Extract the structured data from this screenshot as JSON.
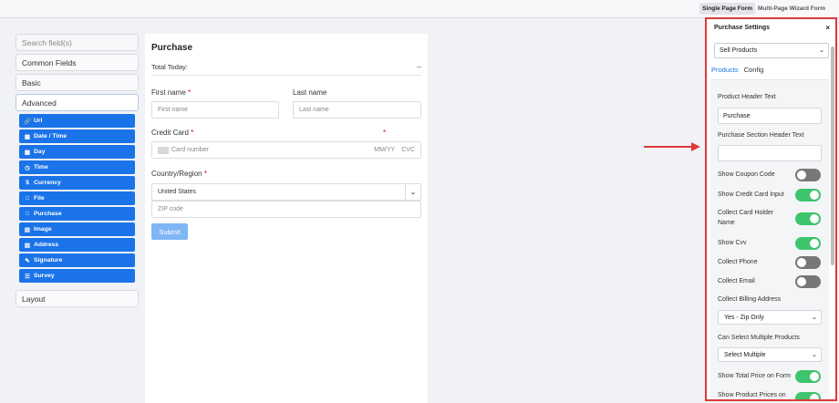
{
  "topbar": {
    "modes": [
      "Single Page Form",
      "Multi-Page Wizard Form"
    ],
    "active_mode": "Single Page Form"
  },
  "sidebar": {
    "search_placeholder": "Search field(s)",
    "sections": {
      "common": "Common Fields",
      "basic": "Basic",
      "advanced": "Advanced",
      "layout": "Layout"
    },
    "advanced_items": [
      {
        "label": "Url",
        "icon": "link-icon"
      },
      {
        "label": "Date / Time",
        "icon": "calendar-icon"
      },
      {
        "label": "Day",
        "icon": "calendar-icon"
      },
      {
        "label": "Time",
        "icon": "clock-icon"
      },
      {
        "label": "Currency",
        "icon": "dollar-icon"
      },
      {
        "label": "File",
        "icon": "file-icon"
      },
      {
        "label": "Purchase",
        "icon": "file-icon"
      },
      {
        "label": "Image",
        "icon": "image-icon"
      },
      {
        "label": "Address",
        "icon": "address-card-icon"
      },
      {
        "label": "Signature",
        "icon": "pen-icon"
      },
      {
        "label": "Survey",
        "icon": "list-icon"
      }
    ]
  },
  "form": {
    "title": "Purchase",
    "total_label": "Total Today:",
    "total_value": "--",
    "first_name_label": "First name",
    "first_name_placeholder": "First name",
    "last_name_label": "Last name",
    "last_name_placeholder": "Last name",
    "credit_card_label": "Credit Card",
    "required_mark": "*",
    "card_number_placeholder": "Card number",
    "card_expiry_placeholder": "MM/YY",
    "card_cvc_placeholder": "CVC",
    "country_label": "Country/Region",
    "country_value": "United States",
    "zip_placeholder": "ZIP code",
    "submit_label": "Submit"
  },
  "panel": {
    "title": "Purchase Settings",
    "close": "×",
    "type_select": "Sell Products",
    "tabs": [
      "Products",
      "Config"
    ],
    "product_header_label": "Product Header Text",
    "product_header_value": "Purchase",
    "section_header_label": "Purchase Section Header Text",
    "section_header_value": "",
    "toggles": {
      "coupon": {
        "label": "Show Coupon Code",
        "on": false
      },
      "credit_card": {
        "label": "Show Credit Card Input",
        "on": true
      },
      "holder": {
        "label": "Collect Card Holder Name",
        "on": true
      },
      "cvv": {
        "label": "Show Cvv",
        "on": true
      },
      "phone": {
        "label": "Collect Phone",
        "on": false
      },
      "email": {
        "label": "Collect Email",
        "on": false
      },
      "total_price": {
        "label": "Show Total Price on Form",
        "on": true
      },
      "product_prices": {
        "label": "Show Product Prices on",
        "on": true
      }
    },
    "billing_label": "Collect Billing Address",
    "billing_value": "Yes - Zip Only",
    "multi_label": "Can Select Multiple Products",
    "multi_value": "Select Multiple"
  },
  "colors": {
    "accent": "#1a73e8",
    "toggle_on": "#3ec46d",
    "toggle_off": "#777777",
    "highlight": "#e03a3a"
  }
}
